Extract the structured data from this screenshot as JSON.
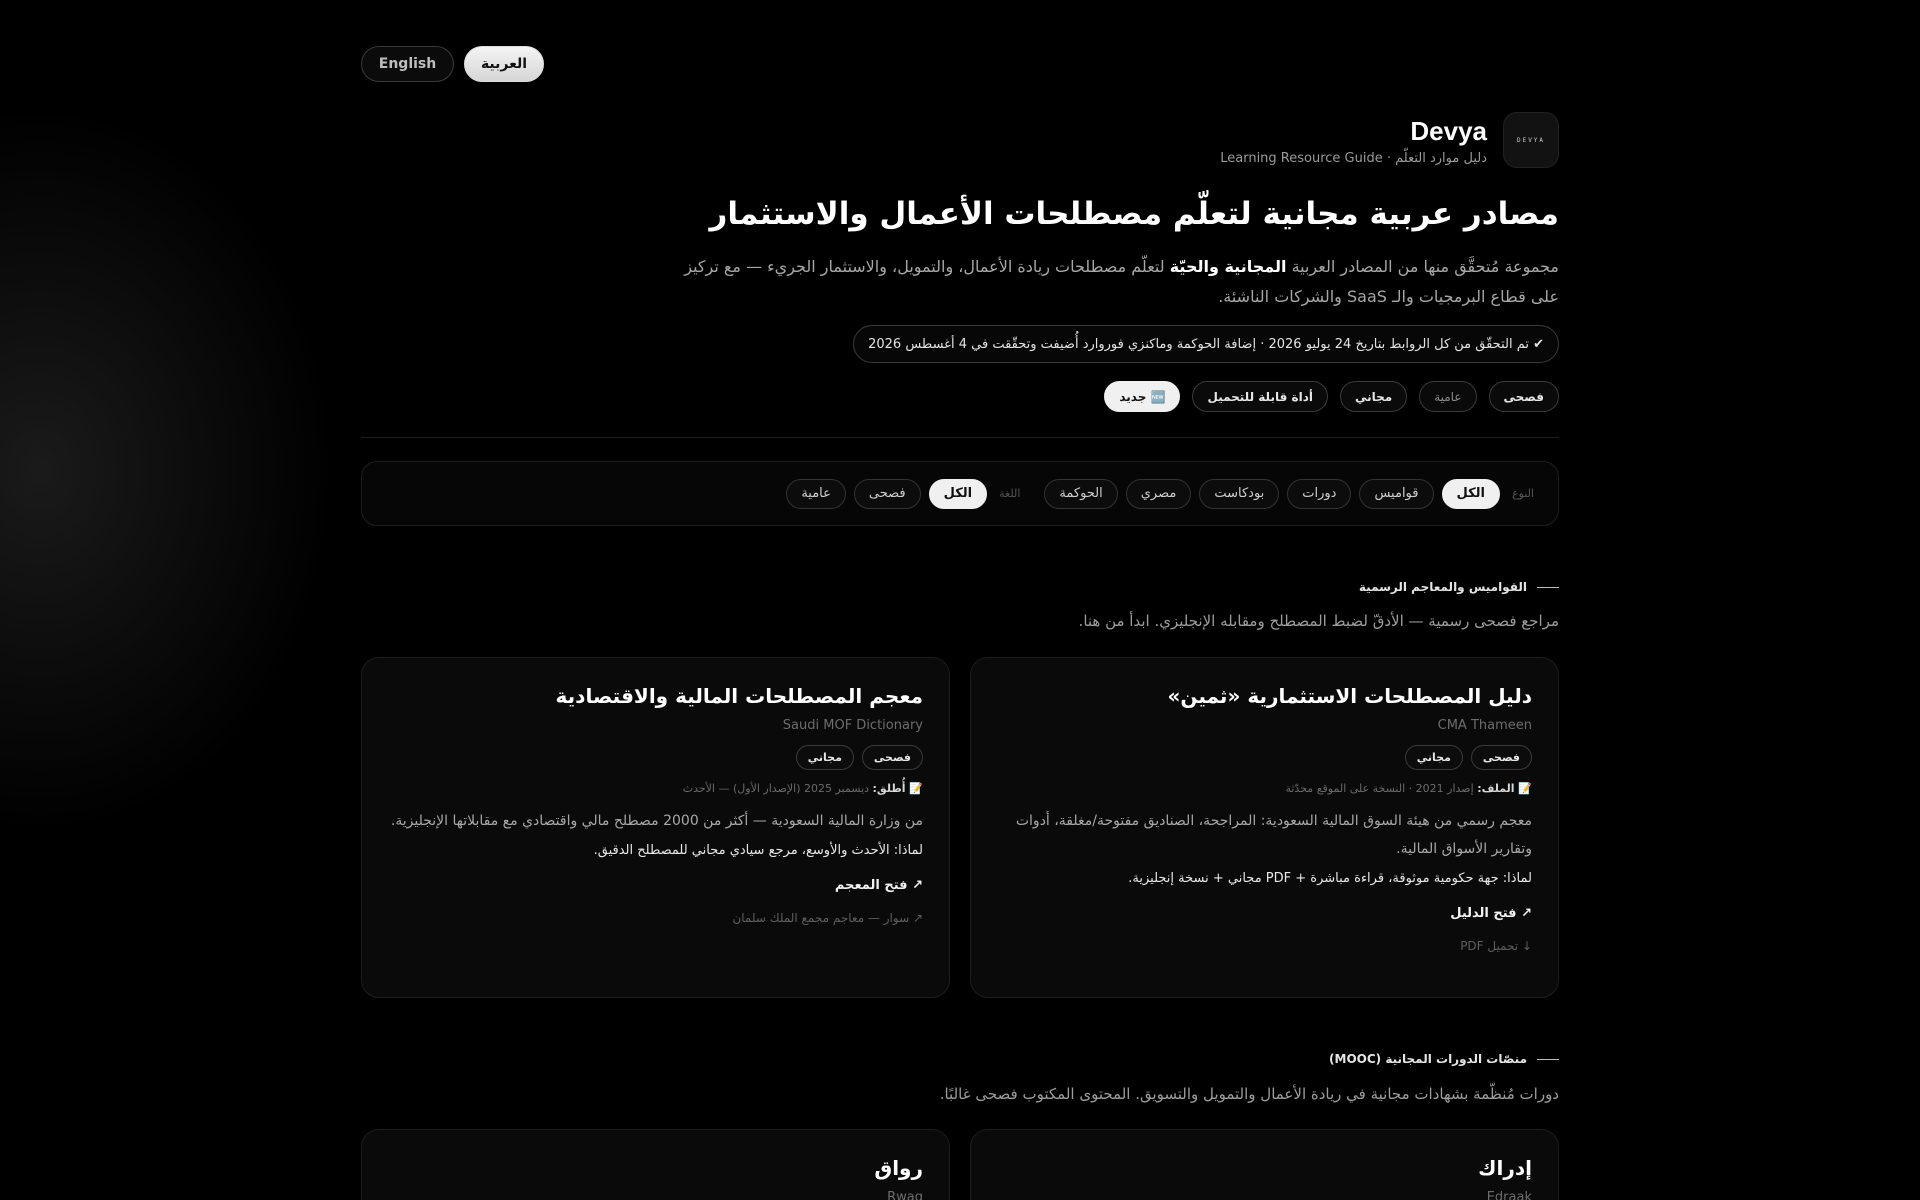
{
  "lang": {
    "en_label": "English",
    "ar_label": "العربية"
  },
  "brand": {
    "logo_text": "DEVYA",
    "name": "Devya",
    "subtitle": "دليل موارد التعلّم · Learning Resource Guide"
  },
  "hero": {
    "title": "مصادر عربية مجانية لتعلّم مصطلحات الأعمال والاستثمار",
    "desc_before": "مجموعة مُتحقَّق منها من المصادر العربية ",
    "desc_bold": "المجانية والحيّة",
    "desc_after": " لتعلّم مصطلحات ريادة الأعمال، والتمويل، والاستثمار الجريء — مع تركيز على قطاع البرمجيات والـ SaaS والشركات الناشئة.",
    "verified_note": "✔ تم التحقّق من كل الروابط بتاريخ 24 يوليو 2026 · إضافة الحوكمة وماكنزي فوروارد أُضيفت وتحقّقت في 4 أغسطس 2026"
  },
  "legend": {
    "fusha": "فصحى",
    "amiya": "عامية",
    "free": "مجاني",
    "downloadable": "أداة قابلة للتحميل",
    "new": "🆕 جديد"
  },
  "filters": {
    "type_label": "النوع",
    "type_options": [
      "الكل",
      "قواميس",
      "دورات",
      "بودكاست",
      "مصري",
      "الحوكمة"
    ],
    "lang_label": "اللغة",
    "lang_options": [
      "الكل",
      "فصحى",
      "عامية"
    ]
  },
  "sections": [
    {
      "title": "القواميس والمعاجم الرسمية",
      "desc": "مراجع فصحى رسمية — الأدقّ لضبط المصطلح ومقابله الإنجليزي. ابدأ من هنا."
    },
    {
      "title": "منصّات الدورات المجانية (MOOC)",
      "desc": "دورات مُنظّمة بشهادات مجانية في ريادة الأعمال والتمويل والتسويق. المحتوى المكتوب فصحى غالبًا."
    }
  ],
  "cards": [
    {
      "title": "دليل المصطلحات الاستثمارية «ثمين»",
      "subtitle": "CMA Thameen",
      "tags": [
        "فصحى",
        "مجاني"
      ],
      "meta_label": "📝 الملف:",
      "meta_value": " إصدار 2021 · النسخة على الموقع محدّثة",
      "body": "معجم رسمي من هيئة السوق المالية السعودية: المراجحة، الصناديق مفتوحة/مغلقة، أدوات وتقارير الأسواق المالية.",
      "why": "لماذا: جهة حكومية موثوقة، قراءة مباشرة + PDF مجاني + نسخة إنجليزية.",
      "link": "↗ فتح الدليل",
      "foot": "↓ تحميل PDF"
    },
    {
      "title": "معجم المصطلحات المالية والاقتصادية",
      "subtitle": "Saudi MOF Dictionary",
      "tags": [
        "فصحى",
        "مجاني"
      ],
      "meta_label": "📝 أُطلق:",
      "meta_value": " ديسمبر 2025 (الإصدار الأول) — الأحدث",
      "body": "من وزارة المالية السعودية — أكثر من 2000 مصطلح مالي واقتصادي مع مقابلاتها الإنجليزية.",
      "why": "لماذا: الأحدث والأوسع، مرجع سيادي مجاني للمصطلح الدقيق.",
      "link": "↗ فتح المعجم",
      "foot": "↗ سوار — معاجم مجمع الملك سلمان"
    },
    {
      "title": "إدراك",
      "subtitle": "Edraak"
    },
    {
      "title": "رواق",
      "subtitle": "Rwaq"
    }
  ]
}
